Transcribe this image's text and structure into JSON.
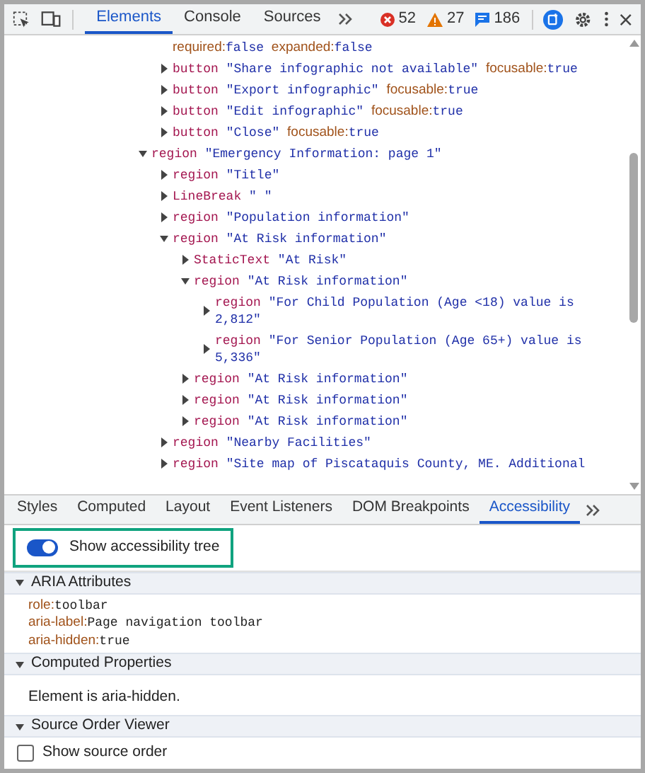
{
  "toolbar": {
    "tabs": [
      {
        "label": "Elements",
        "selected": true
      },
      {
        "label": "Console",
        "selected": false
      },
      {
        "label": "Sources",
        "selected": false
      }
    ],
    "errors": "52",
    "warnings": "27",
    "messages": "186"
  },
  "tree": [
    {
      "kind": "group",
      "children": [
        {
          "kind": "props",
          "props": [
            {
              "key": "required:",
              "value": "false"
            },
            {
              "key": "expanded:",
              "value": "false"
            }
          ]
        },
        {
          "kind": "node",
          "role": "button",
          "name": "\"Share infographic not available\"",
          "props": [
            {
              "key": "focusable:",
              "value": "true"
            }
          ],
          "expanded": false
        },
        {
          "kind": "node",
          "role": "button",
          "name": "\"Export infographic\"",
          "props": [
            {
              "key": "focusable:",
              "value": "true"
            }
          ],
          "expanded": false
        },
        {
          "kind": "node",
          "role": "button",
          "name": "\"Edit infographic\"",
          "props": [
            {
              "key": "focusable:",
              "value": "true"
            }
          ],
          "expanded": false
        },
        {
          "kind": "node",
          "role": "button",
          "name": "\"Close\"",
          "props": [
            {
              "key": "focusable:",
              "value": "true"
            }
          ],
          "expanded": false
        }
      ]
    },
    {
      "kind": "node",
      "role": "region",
      "name": "\"Emergency Information: page 1\"",
      "expanded": true,
      "children": [
        {
          "kind": "node",
          "role": "region",
          "name": "\"Title\"",
          "expanded": false
        },
        {
          "kind": "node",
          "role": "LineBreak",
          "name": "\" \"",
          "expanded": false
        },
        {
          "kind": "node",
          "role": "region",
          "name": "\"Population information\"",
          "expanded": false
        },
        {
          "kind": "node",
          "role": "region",
          "name": "\"At Risk information\"",
          "expanded": true,
          "children": [
            {
              "kind": "node",
              "role": "StaticText",
              "name": "\"At Risk\"",
              "expanded": false
            },
            {
              "kind": "node",
              "role": "region",
              "name": "\"At Risk information\"",
              "expanded": true,
              "children": [
                {
                  "kind": "node",
                  "role": "region",
                  "name": "\"For Child Population (Age <18) value is 2,812\"",
                  "expanded": false
                },
                {
                  "kind": "node",
                  "role": "region",
                  "name": "\"For Senior Population (Age 65+) value is 5,336\"",
                  "expanded": false
                }
              ]
            },
            {
              "kind": "node",
              "role": "region",
              "name": "\"At Risk information\"",
              "expanded": false
            },
            {
              "kind": "node",
              "role": "region",
              "name": "\"At Risk information\"",
              "expanded": false
            },
            {
              "kind": "node",
              "role": "region",
              "name": "\"At Risk information\"",
              "expanded": false
            }
          ]
        },
        {
          "kind": "node",
          "role": "region",
          "name": "\"Nearby Facilities\"",
          "expanded": false
        },
        {
          "kind": "node",
          "role": "region",
          "name": "\"Site map of Piscataquis County, ME. Additional",
          "expanded": false
        }
      ]
    }
  ],
  "panel_tabs": [
    {
      "label": "Styles",
      "selected": false
    },
    {
      "label": "Computed",
      "selected": false
    },
    {
      "label": "Layout",
      "selected": false
    },
    {
      "label": "Event Listeners",
      "selected": false
    },
    {
      "label": "DOM Breakpoints",
      "selected": false
    },
    {
      "label": "Accessibility",
      "selected": true
    }
  ],
  "accessibility_tree_toggle": {
    "label": "Show accessibility tree",
    "on": true
  },
  "sections": [
    {
      "kind": "attributes",
      "title": "ARIA Attributes",
      "expanded": true,
      "attributes": [
        {
          "key": "role:",
          "value": "toolbar"
        },
        {
          "key": "aria-label:",
          "value": "Page navigation toolbar"
        },
        {
          "key": "aria-hidden:",
          "value": "true"
        }
      ]
    },
    {
      "kind": "text",
      "title": "Computed Properties",
      "expanded": true,
      "text": "Element is aria-hidden."
    },
    {
      "kind": "checkbox",
      "title": "Source Order Viewer",
      "expanded": true,
      "label": "Show source order",
      "checked": false
    }
  ]
}
